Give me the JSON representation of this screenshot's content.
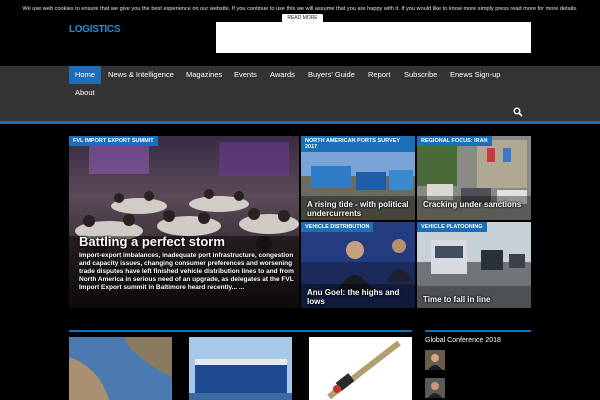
{
  "cookie": {
    "text": "We use web cookies to ensure that we give you the best experience on our website. If you continue to use this we will assume that you are happy with it. If you would like to know more simply press read more for more details.",
    "read_more": "READ MORE"
  },
  "brand": {
    "logo": "LOGISTICS"
  },
  "nav": {
    "items": [
      "Home",
      "News & Intelligence",
      "Magazines",
      "Events",
      "Awards",
      "Buyers' Guide",
      "Report",
      "Subscribe",
      "Enews Sign-up"
    ],
    "second_row": "About",
    "active": "Home"
  },
  "featured": {
    "category": "FVL IMPORT EXPORT SUMMIT",
    "title": "Battling a perfect storm",
    "excerpt": "Import-export imbalances, inadequate port infrastructure, congestion and capacity issues, changing consumer preferences and worsening trade disputes have left finished vehicle distribution lines to and from North America in serious need of an upgrade, as delegates at the FVL Import Export summit in Baltimore heard recently... ..."
  },
  "tiles": [
    {
      "category": "NORTH AMERICAN PORTS SURVEY 2017",
      "title": "A rising tide - with political undercurrents"
    },
    {
      "category": "REGIONAL FOCUS: IRAN",
      "title": "Cracking under sanctions"
    },
    {
      "category": "VEHICLE DISTRIBUTION",
      "title": "Anu Goel: the highs and lows"
    },
    {
      "category": "VEHICLE PLATOONING",
      "title": "Time to fall in line"
    }
  ],
  "sidebar": {
    "title": "Global Conference 2018"
  },
  "colors": {
    "accent": "#1a6fb8",
    "nav_bg": "#333333",
    "page_bg": "#000000"
  }
}
